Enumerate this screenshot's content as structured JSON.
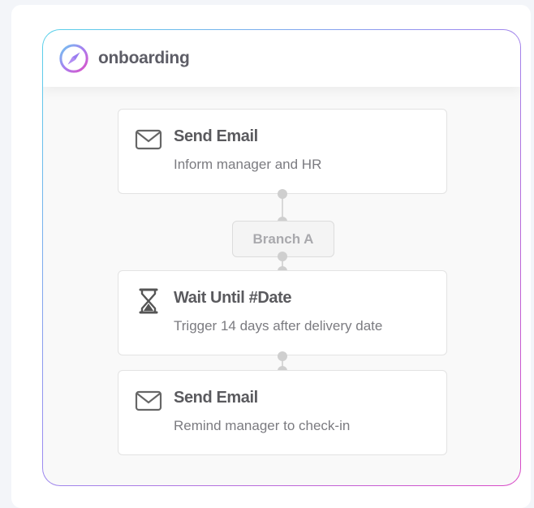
{
  "flow": {
    "title": "onboarding",
    "icon": "compass-icon",
    "accent_gradient": [
      "#58d2ea",
      "#9a8cf0",
      "#d948c6"
    ]
  },
  "nodes": [
    {
      "icon": "mail-icon",
      "title": "Send Email",
      "subtitle": "Inform manager and HR"
    },
    {
      "icon": "hourglass-icon",
      "title": "Wait Until #Date",
      "subtitle": "Trigger 14 days after delivery date"
    },
    {
      "icon": "mail-icon",
      "title": "Send Email",
      "subtitle": "Remind manager to check-in"
    }
  ],
  "branch": {
    "label": "Branch A"
  }
}
